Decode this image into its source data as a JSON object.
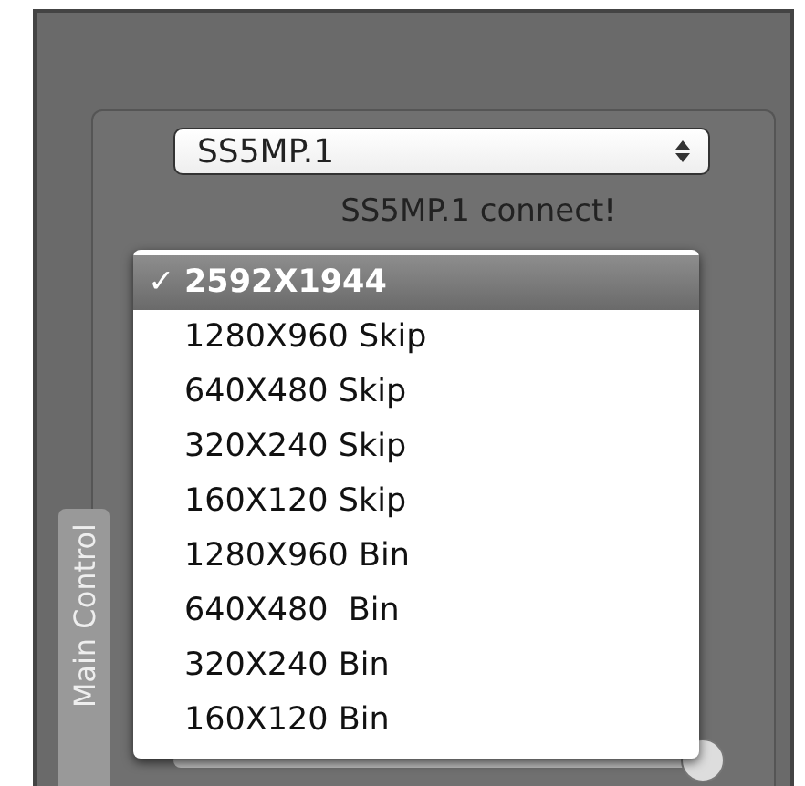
{
  "device_select": {
    "value": "SS5MP.1"
  },
  "status": "SS5MP.1 connect!",
  "resolution_menu": {
    "check_mark": "✓",
    "items": [
      {
        "label": "2592X1944",
        "selected": true
      },
      {
        "label": "1280X960 Skip",
        "selected": false
      },
      {
        "label": "640X480 Skip",
        "selected": false
      },
      {
        "label": "320X240 Skip",
        "selected": false
      },
      {
        "label": "160X120 Skip",
        "selected": false
      },
      {
        "label": "1280X960 Bin",
        "selected": false
      },
      {
        "label": "640X480  Bin",
        "selected": false
      },
      {
        "label": "320X240 Bin",
        "selected": false
      },
      {
        "label": "160X120 Bin",
        "selected": false
      }
    ]
  },
  "side_tab": {
    "label": "Main Control"
  }
}
